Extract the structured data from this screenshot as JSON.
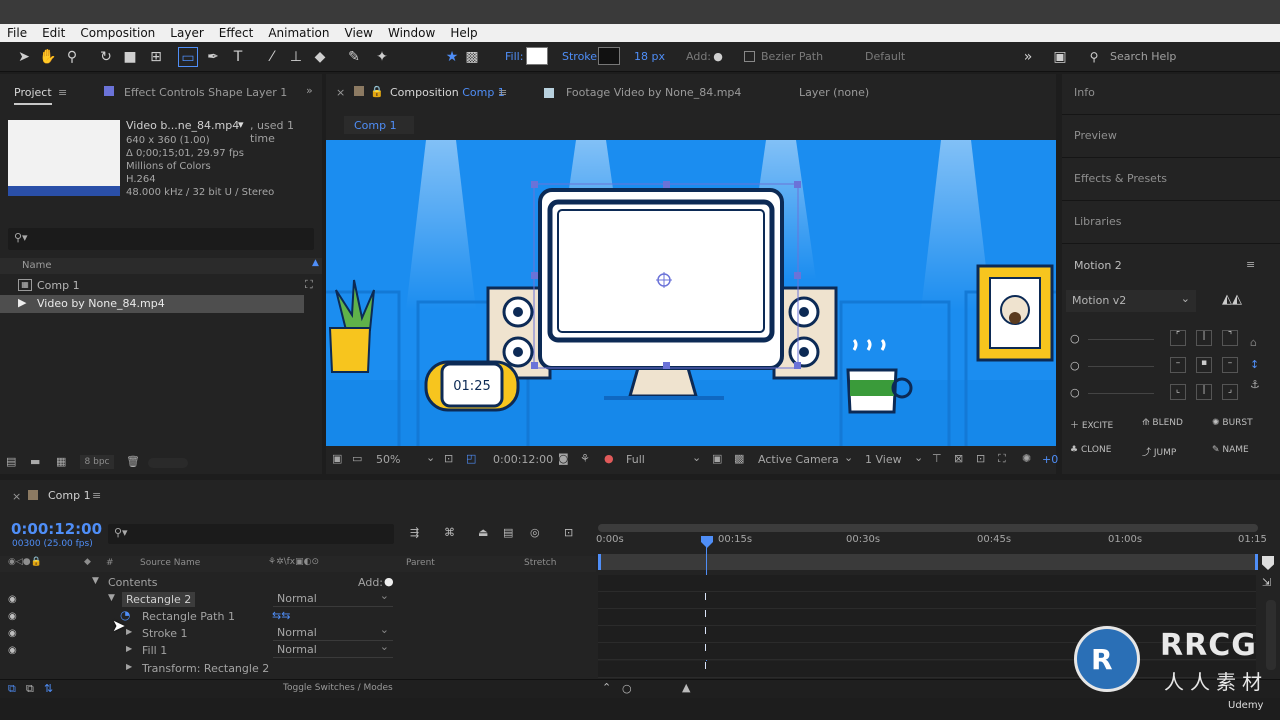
{
  "menu": [
    "File",
    "Edit",
    "Composition",
    "Layer",
    "Effect",
    "Animation",
    "View",
    "Window",
    "Help"
  ],
  "toolbar": {
    "fill_label": "Fill:",
    "stroke_label": "Stroke:",
    "stroke_width": "18 px",
    "add_label": "Add:",
    "bezier_label": "Bezier Path",
    "workspace": "Default",
    "search_placeholder": "Search Help"
  },
  "project": {
    "tab": "Project",
    "effect_tab": "Effect Controls Shape Layer 1",
    "item_name": "Video b...ne_84.mp4",
    "used": ", used 1 time",
    "info": [
      "640 x 360 (1.00)",
      "Δ 0;00;15;01, 29.97 fps",
      "Millions of Colors",
      "H.264",
      "48.000 kHz / 32 bit U / Stereo"
    ],
    "col_name": "Name",
    "items": [
      "Comp 1",
      "Video by None_84.mp4"
    ],
    "bpc": "8 bpc"
  },
  "comp": {
    "tab_prefix": "Composition",
    "tab_name": "Comp 1",
    "footage_tab": "Footage Video by None_84.mp4",
    "layer_tab": "Layer (none)",
    "breadcrumb": "Comp 1",
    "clock": "01:25"
  },
  "viewer_bar": {
    "zoom": "50%",
    "time": "0:00:12:00",
    "quality": "Full",
    "camera": "Active Camera",
    "views": "1 View",
    "offset": "+0"
  },
  "right_panel": {
    "items": [
      "Info",
      "Preview",
      "Effects & Presets",
      "Libraries"
    ],
    "motion_title": "Motion 2",
    "motion_select": "Motion v2",
    "actions": [
      "EXCITE",
      "BLEND",
      "BURST",
      "CLONE",
      "JUMP",
      "NAME"
    ]
  },
  "timeline": {
    "tab": "Comp 1",
    "timecode": "0:00:12:00",
    "frames": "00300 (25.00 fps)",
    "col_source": "Source Name",
    "col_parent": "Parent",
    "col_stretch": "Stretch",
    "ruler": [
      "0:00s",
      "00:15s",
      "00:30s",
      "00:45s",
      "01:00s",
      "01:15"
    ],
    "contents": "Contents",
    "add": "Add:",
    "layers": [
      {
        "name": "Rectangle 2",
        "mode": "Normal"
      },
      {
        "name": "Rectangle Path 1",
        "mode": ""
      },
      {
        "name": "Stroke 1",
        "mode": "Normal"
      },
      {
        "name": "Fill 1",
        "mode": "Normal"
      },
      {
        "name": "Transform: Rectangle 2",
        "mode": ""
      }
    ],
    "toggle": "Toggle Switches / Modes"
  },
  "watermark": {
    "brand": "RRCG",
    "sub": "人人素材",
    "udemy": "Udemy"
  }
}
